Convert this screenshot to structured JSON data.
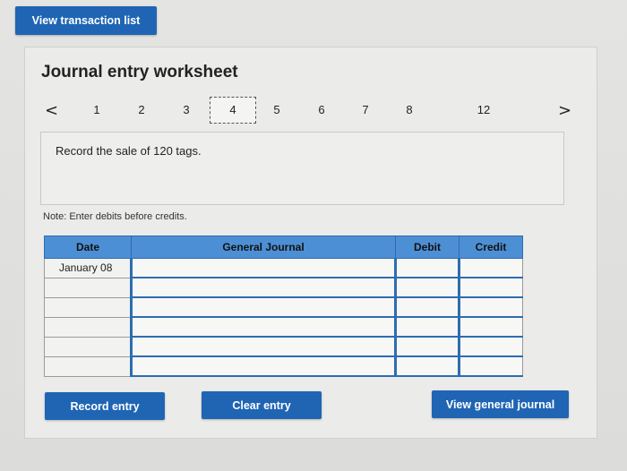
{
  "top": {
    "view_transaction_label": "View transaction list"
  },
  "worksheet": {
    "title": "Journal entry worksheet",
    "pager": {
      "prev": "<",
      "next": ">",
      "pages": [
        "1",
        "2",
        "3",
        "4",
        "5",
        "6",
        "7",
        "8",
        "12"
      ],
      "active_index": 3
    },
    "description": "Record the sale of 120 tags.",
    "note": "Note: Enter debits before credits."
  },
  "table": {
    "headers": {
      "date": "Date",
      "journal": "General Journal",
      "debit": "Debit",
      "credit": "Credit"
    },
    "rows": [
      {
        "date": "January 08",
        "journal": "",
        "debit": "",
        "credit": ""
      },
      {
        "date": "",
        "journal": "",
        "debit": "",
        "credit": ""
      },
      {
        "date": "",
        "journal": "",
        "debit": "",
        "credit": ""
      },
      {
        "date": "",
        "journal": "",
        "debit": "",
        "credit": ""
      },
      {
        "date": "",
        "journal": "",
        "debit": "",
        "credit": ""
      },
      {
        "date": "",
        "journal": "",
        "debit": "",
        "credit": ""
      }
    ]
  },
  "buttons": {
    "record": "Record entry",
    "clear": "Clear entry",
    "view_general_journal": "View general journal"
  },
  "colors": {
    "button_blue": "#1f65b4",
    "header_blue": "#4d8fd4"
  }
}
